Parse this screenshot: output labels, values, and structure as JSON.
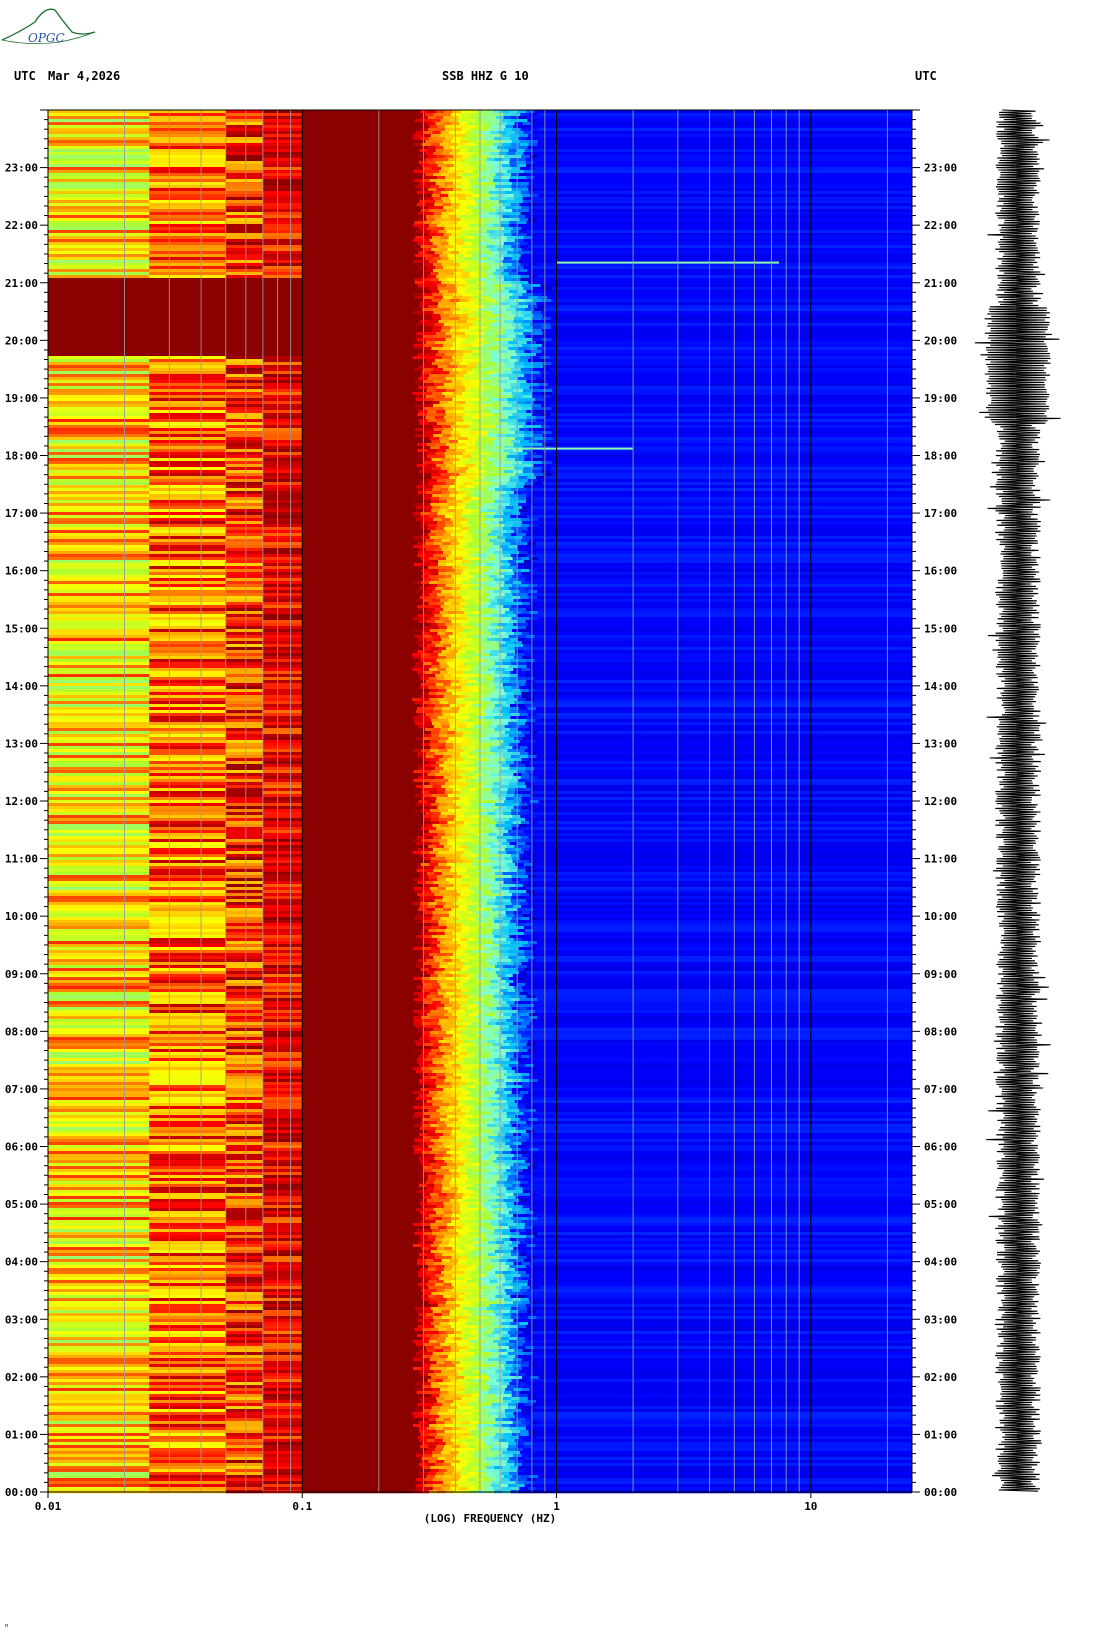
{
  "header": {
    "utc_left": "UTC",
    "date": "Mar 4,2026",
    "station": "SSB HHZ G 10",
    "utc_right": "UTC"
  },
  "logo": {
    "text": "OPGC",
    "color": "#1a6e2e"
  },
  "corner_mark": "ⁿ",
  "chart_data": {
    "type": "heatmap",
    "title": "SSB HHZ G 10",
    "xlabel": "(LOG) FREQUENCY (HZ)",
    "ylabel": "UTC",
    "x_scale": "log",
    "x_range": [
      0.01,
      25
    ],
    "x_ticks": [
      {
        "value": 0.01,
        "label": "0.01"
      },
      {
        "value": 0.1,
        "label": "0.1"
      },
      {
        "value": 1,
        "label": "1"
      },
      {
        "value": 10,
        "label": "10"
      }
    ],
    "y_range_hours": [
      0,
      24
    ],
    "y_ticks": [
      "00:00",
      "01:00",
      "02:00",
      "03:00",
      "04:00",
      "05:00",
      "06:00",
      "07:00",
      "08:00",
      "09:00",
      "10:00",
      "11:00",
      "12:00",
      "13:00",
      "14:00",
      "15:00",
      "16:00",
      "17:00",
      "18:00",
      "19:00",
      "20:00",
      "21:00",
      "22:00",
      "23:00"
    ],
    "colormap": [
      "#00008b",
      "#0000ff",
      "#00bfff",
      "#7fffd4",
      "#adff2f",
      "#ffff00",
      "#ffa500",
      "#ff0000",
      "#8b0000"
    ],
    "colormap_note": "high energy = dark red, low energy = dark blue",
    "strong_energy_period_hours": [
      19.75,
      21.1
    ],
    "highlight_events": [
      {
        "hour": 18.12,
        "freq_range_hz": [
          0.6,
          2.0
        ]
      },
      {
        "hour": 21.35,
        "freq_range_hz": [
          1.0,
          7.5
        ]
      }
    ],
    "seismogram_trace": "right-hand vertical time series, amplitude increased near 19:00-20:00"
  }
}
